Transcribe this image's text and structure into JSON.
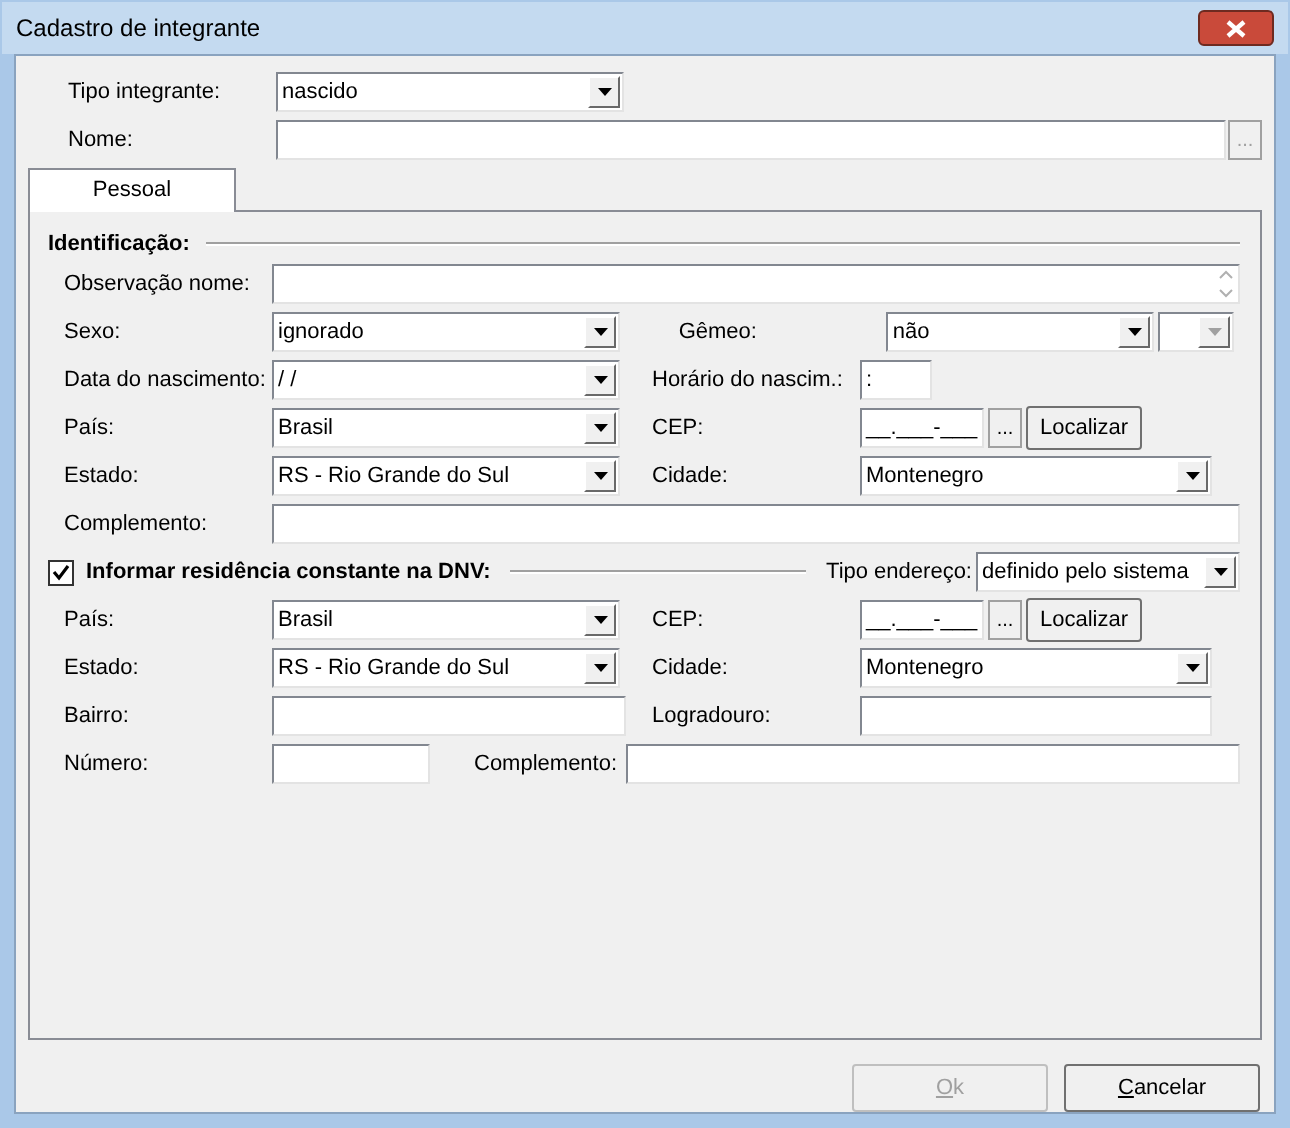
{
  "window": {
    "title": "Cadastro de integrante"
  },
  "tipo_integrante": {
    "label": "Tipo integrante:",
    "value": "nascido"
  },
  "nome": {
    "label": "Nome:",
    "lookup_label": "...",
    "lookup_disabled": true
  },
  "tabs": [
    {
      "label": "Pessoal",
      "selected": true
    }
  ],
  "identificacao": {
    "title": "Identificação:",
    "observacao_nome": {
      "label": "Observação nome:"
    },
    "sexo": {
      "label": "Sexo:",
      "value": "ignorado"
    },
    "gemeo": {
      "label": "Gêmeo:",
      "value": "não",
      "extra_disabled": true
    },
    "data_nascimento": {
      "label": "Data do nascimento:",
      "value": " / /"
    },
    "horario": {
      "label": "Horário do nascim.:",
      "value": ":"
    },
    "pais": {
      "label": "País:",
      "value": "Brasil"
    },
    "cep": {
      "label": "CEP:",
      "value": "__.___-___",
      "lookup_label": "...",
      "button": "Localizar"
    },
    "estado": {
      "label": "Estado:",
      "value": "RS - Rio Grande do Sul"
    },
    "cidade": {
      "label": "Cidade:",
      "value": "Montenegro"
    },
    "complemento": {
      "label": "Complemento:"
    }
  },
  "residencia": {
    "title": "Informar residência constante na DNV:",
    "checked": true,
    "tipo_endereco": {
      "label": "Tipo endereço:",
      "value": "definido pelo sistema"
    },
    "pais": {
      "label": "País:",
      "value": "Brasil"
    },
    "cep": {
      "label": "CEP:",
      "value": "__.___-___",
      "lookup_label": "...",
      "button": "Localizar"
    },
    "estado": {
      "label": "Estado:",
      "value": "RS - Rio Grande do Sul"
    },
    "cidade": {
      "label": "Cidade:",
      "value": "Montenegro"
    },
    "bairro": {
      "label": "Bairro:"
    },
    "logradouro": {
      "label": "Logradouro:"
    },
    "numero": {
      "label": "Número:"
    },
    "complemento": {
      "label": "Complemento:"
    }
  },
  "buttons": [
    {
      "label": "Ok",
      "disabled": true
    },
    {
      "label": "Cancelar",
      "disabled": false
    }
  ]
}
